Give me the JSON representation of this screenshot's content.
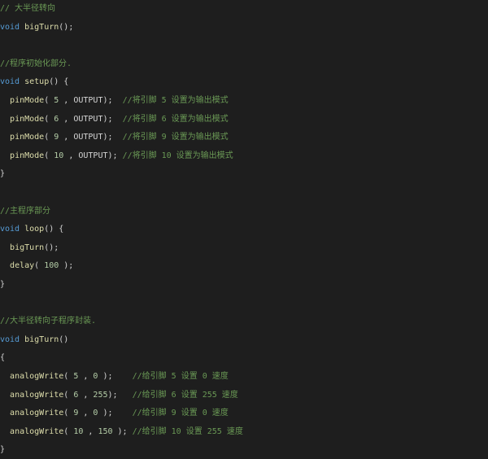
{
  "editor": {
    "colors": {
      "background": "#1e1e1e",
      "keyword": "#569cd6",
      "function": "#dcdcaa",
      "comment": "#6a9955",
      "number": "#b5cea8",
      "text": "#d4d4d4"
    },
    "lines": [
      {
        "tokens": [
          {
            "t": "// 大半径转向",
            "c": "cm"
          }
        ]
      },
      {
        "tokens": [
          {
            "t": "void",
            "c": "kw"
          },
          {
            "t": " ",
            "c": "txt"
          },
          {
            "t": "bigTurn",
            "c": "fn"
          },
          {
            "t": "();",
            "c": "txt"
          }
        ]
      },
      {
        "tokens": []
      },
      {
        "tokens": [
          {
            "t": "//程序初始化部分.",
            "c": "cm"
          }
        ]
      },
      {
        "tokens": [
          {
            "t": "void",
            "c": "kw"
          },
          {
            "t": " ",
            "c": "txt"
          },
          {
            "t": "setup",
            "c": "fn"
          },
          {
            "t": "() {",
            "c": "txt"
          }
        ]
      },
      {
        "tokens": [
          {
            "t": "  ",
            "c": "txt"
          },
          {
            "t": "pinMode",
            "c": "fn"
          },
          {
            "t": "( ",
            "c": "txt"
          },
          {
            "t": "5",
            "c": "num"
          },
          {
            "t": " , OUTPUT);  ",
            "c": "txt"
          },
          {
            "t": "//将引脚 5 设置为输出模式",
            "c": "cm"
          }
        ]
      },
      {
        "tokens": [
          {
            "t": "  ",
            "c": "txt"
          },
          {
            "t": "pinMode",
            "c": "fn"
          },
          {
            "t": "( ",
            "c": "txt"
          },
          {
            "t": "6",
            "c": "num"
          },
          {
            "t": " , OUTPUT);  ",
            "c": "txt"
          },
          {
            "t": "//将引脚 6 设置为输出模式",
            "c": "cm"
          }
        ]
      },
      {
        "tokens": [
          {
            "t": "  ",
            "c": "txt"
          },
          {
            "t": "pinMode",
            "c": "fn"
          },
          {
            "t": "( ",
            "c": "txt"
          },
          {
            "t": "9",
            "c": "num"
          },
          {
            "t": " , OUTPUT);  ",
            "c": "txt"
          },
          {
            "t": "//将引脚 9 设置为输出模式",
            "c": "cm"
          }
        ]
      },
      {
        "tokens": [
          {
            "t": "  ",
            "c": "txt"
          },
          {
            "t": "pinMode",
            "c": "fn"
          },
          {
            "t": "( ",
            "c": "txt"
          },
          {
            "t": "10",
            "c": "num"
          },
          {
            "t": " , OUTPUT); ",
            "c": "txt"
          },
          {
            "t": "//将引脚 10 设置为输出模式",
            "c": "cm"
          }
        ]
      },
      {
        "tokens": [
          {
            "t": "}",
            "c": "txt"
          }
        ]
      },
      {
        "tokens": []
      },
      {
        "tokens": [
          {
            "t": "//主程序部分",
            "c": "cm"
          }
        ]
      },
      {
        "tokens": [
          {
            "t": "void",
            "c": "kw"
          },
          {
            "t": " ",
            "c": "txt"
          },
          {
            "t": "loop",
            "c": "fn"
          },
          {
            "t": "() {",
            "c": "txt"
          }
        ]
      },
      {
        "tokens": [
          {
            "t": "  ",
            "c": "txt"
          },
          {
            "t": "bigTurn",
            "c": "fn"
          },
          {
            "t": "();",
            "c": "txt"
          }
        ]
      },
      {
        "tokens": [
          {
            "t": "  ",
            "c": "txt"
          },
          {
            "t": "delay",
            "c": "fn"
          },
          {
            "t": "( ",
            "c": "txt"
          },
          {
            "t": "100",
            "c": "num"
          },
          {
            "t": " );",
            "c": "txt"
          }
        ]
      },
      {
        "tokens": [
          {
            "t": "}",
            "c": "txt"
          }
        ]
      },
      {
        "tokens": []
      },
      {
        "tokens": [
          {
            "t": "//大半径转向子程序封装.",
            "c": "cm"
          }
        ]
      },
      {
        "tokens": [
          {
            "t": "void",
            "c": "kw"
          },
          {
            "t": " ",
            "c": "txt"
          },
          {
            "t": "bigTurn",
            "c": "fn"
          },
          {
            "t": "()",
            "c": "txt"
          }
        ]
      },
      {
        "tokens": [
          {
            "t": "{",
            "c": "txt"
          }
        ]
      },
      {
        "tokens": [
          {
            "t": "  ",
            "c": "txt"
          },
          {
            "t": "analogWrite",
            "c": "fn"
          },
          {
            "t": "( ",
            "c": "txt"
          },
          {
            "t": "5",
            "c": "num"
          },
          {
            "t": " , ",
            "c": "txt"
          },
          {
            "t": "0",
            "c": "num"
          },
          {
            "t": " );    ",
            "c": "txt"
          },
          {
            "t": "//给引脚 5 设置 0 速度",
            "c": "cm"
          }
        ]
      },
      {
        "tokens": [
          {
            "t": "  ",
            "c": "txt"
          },
          {
            "t": "analogWrite",
            "c": "fn"
          },
          {
            "t": "( ",
            "c": "txt"
          },
          {
            "t": "6",
            "c": "num"
          },
          {
            "t": " , ",
            "c": "txt"
          },
          {
            "t": "255",
            "c": "num"
          },
          {
            "t": ");   ",
            "c": "txt"
          },
          {
            "t": "//给引脚 6 设置 255 速度",
            "c": "cm"
          }
        ]
      },
      {
        "tokens": [
          {
            "t": "  ",
            "c": "txt"
          },
          {
            "t": "analogWrite",
            "c": "fn"
          },
          {
            "t": "( ",
            "c": "txt"
          },
          {
            "t": "9",
            "c": "num"
          },
          {
            "t": " , ",
            "c": "txt"
          },
          {
            "t": "0",
            "c": "num"
          },
          {
            "t": " );    ",
            "c": "txt"
          },
          {
            "t": "//给引脚 9 设置 0 速度",
            "c": "cm"
          }
        ]
      },
      {
        "tokens": [
          {
            "t": "  ",
            "c": "txt"
          },
          {
            "t": "analogWrite",
            "c": "fn"
          },
          {
            "t": "( ",
            "c": "txt"
          },
          {
            "t": "10",
            "c": "num"
          },
          {
            "t": " , ",
            "c": "txt"
          },
          {
            "t": "150",
            "c": "num"
          },
          {
            "t": " ); ",
            "c": "txt"
          },
          {
            "t": "//给引脚 10 设置 255 速度",
            "c": "cm"
          }
        ]
      },
      {
        "tokens": [
          {
            "t": "}",
            "c": "txt"
          }
        ]
      }
    ]
  }
}
